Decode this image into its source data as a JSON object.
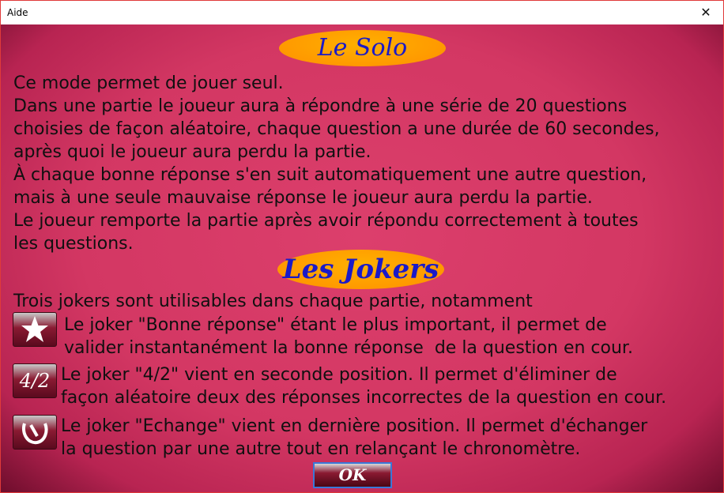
{
  "window": {
    "title": "Aide",
    "close_glyph": "✕"
  },
  "solo": {
    "heading": "Le Solo",
    "lines": [
      "Ce mode permet de jouer seul.",
      "Dans une partie le joueur aura à répondre à une série de 20 questions",
      "choisies de façon aléatoire, chaque question a une durée de 60 secondes,",
      "après quoi le joueur aura perdu la partie.",
      "À chaque bonne réponse s'en suit automatiquement une autre question,",
      "mais à une seule mauvaise réponse le joueur aura perdu la partie.",
      "Le joueur remporte la partie après avoir répondu correctement à toutes",
      "les questions."
    ]
  },
  "jokers": {
    "heading": "Les Jokers",
    "intro": "Trois jokers sont utilisables dans chaque partie, notamment",
    "items": [
      {
        "icon": "star-icon",
        "lines": [
          "Le joker \"Bonne réponse\" étant le plus important, il permet de",
          "valider instantanément la bonne réponse  de la question en cour."
        ]
      },
      {
        "icon": "fifty-fifty-icon",
        "icon_text": "4/2",
        "lines": [
          "Le joker \"4/2\" vient en seconde position. Il permet d'éliminer de",
          "façon aléatoire deux des réponses incorrectes de la question en cour."
        ]
      },
      {
        "icon": "exchange-icon",
        "lines": [
          "Le joker \"Echange\" vient en dernière position. Il permet d'échanger",
          "la question par une autre tout en relançant le chronomètre."
        ]
      }
    ]
  },
  "ok_button": {
    "label": "OK"
  }
}
